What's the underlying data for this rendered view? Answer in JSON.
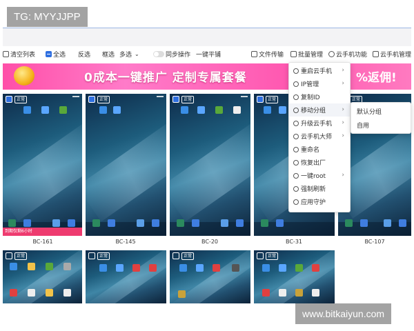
{
  "watermarks": {
    "top": "TG: MYYJJPP",
    "bottom": "www.bitkaiyun.com"
  },
  "toolbar": {
    "clear_list": "清空列表",
    "select_all": "全选",
    "invert": "反选",
    "frame_select": "框选",
    "multi_select": "多选",
    "sync_op": "同步操作",
    "tile": "一键平铺",
    "file_transfer": "文件传输",
    "batch_manage": "批量管理",
    "cloud_func": "云手机功能",
    "cloud_manage": "云手机管理"
  },
  "banner": {
    "text": "0成本一键推广  定制专属套餐",
    "text2": "%返佣!"
  },
  "context_menu": {
    "items": [
      {
        "label": "重启云手机",
        "arrow": "›"
      },
      {
        "label": "IP管理",
        "arrow": "›"
      },
      {
        "label": "复制ID",
        "arrow": ""
      },
      {
        "label": "移动分组",
        "arrow": "›"
      },
      {
        "label": "升级云手机",
        "arrow": "›"
      },
      {
        "label": "云手机大师",
        "arrow": "›"
      },
      {
        "label": "重命名",
        "arrow": ""
      },
      {
        "label": "恢复出厂",
        "arrow": ""
      },
      {
        "label": "一键root",
        "arrow": "›"
      },
      {
        "label": "强制刷新",
        "arrow": ""
      },
      {
        "label": "应用守护",
        "arrow": ""
      }
    ]
  },
  "submenu": {
    "items": [
      "默认分组",
      "自用"
    ]
  },
  "cards_row1": [
    {
      "name": "BC-161",
      "badge": "正常",
      "warn": "到期仅剩6小时"
    },
    {
      "name": "BC-145",
      "badge": "正常"
    },
    {
      "name": "BC-20",
      "badge": "正常"
    },
    {
      "name": "BC-31",
      "badge": "正常"
    },
    {
      "name": "BC-107",
      "badge": "正常"
    }
  ],
  "cards_row2": [
    {
      "badge": "正常"
    },
    {
      "badge": "正常"
    },
    {
      "badge": "正常"
    },
    {
      "badge": "正常"
    }
  ],
  "colors": {
    "accent": "#2f6fe0",
    "banner": "#ff5fb3",
    "warn": "#ee3b6f"
  }
}
